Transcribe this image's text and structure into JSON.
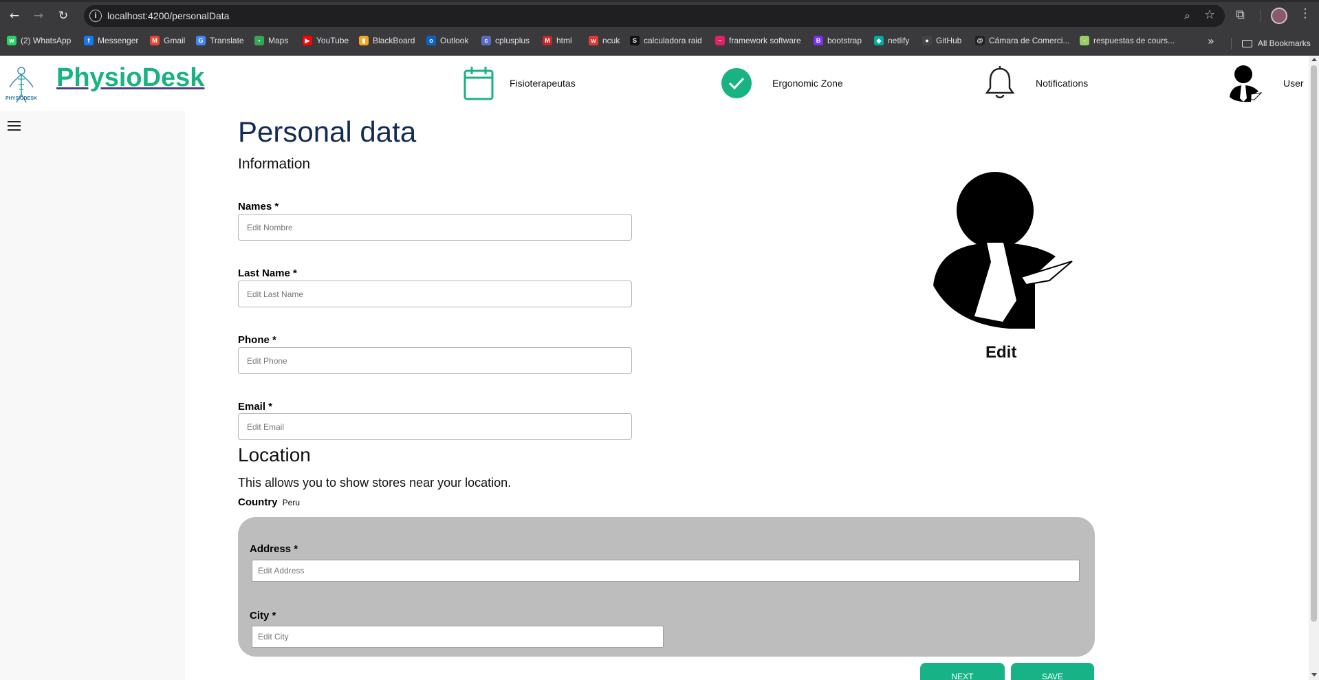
{
  "browser": {
    "url": "localhost:4200/personalData",
    "bookmarks": [
      {
        "label": "(2) WhatsApp",
        "color": "#25d366",
        "glyph": "w"
      },
      {
        "label": "Messenger",
        "color": "#1877f2",
        "glyph": "f"
      },
      {
        "label": "Gmail",
        "color": "#ea4335",
        "glyph": "M"
      },
      {
        "label": "Translate",
        "color": "#4285f4",
        "glyph": "G"
      },
      {
        "label": "Maps",
        "color": "#34a853",
        "glyph": "•"
      },
      {
        "label": "YouTube",
        "color": "#ff0000",
        "glyph": "▶"
      },
      {
        "label": "BlackBoard",
        "color": "#f5a623",
        "glyph": "▮"
      },
      {
        "label": "Outlook",
        "color": "#0a64c9",
        "glyph": "o"
      },
      {
        "label": "cplusplus",
        "color": "#5c6bc0",
        "glyph": "c"
      },
      {
        "label": "html",
        "color": "#c62828",
        "glyph": "M"
      },
      {
        "label": "ncuk",
        "color": "#e53935",
        "glyph": "w"
      },
      {
        "label": "calculadora raid",
        "color": "#111111",
        "glyph": "S"
      },
      {
        "label": "framework software",
        "color": "#e91e63",
        "glyph": "~"
      },
      {
        "label": "bootstrap",
        "color": "#7b2ff7",
        "glyph": "B"
      },
      {
        "label": "netlify",
        "color": "#00ad9f",
        "glyph": "◆"
      },
      {
        "label": "GitHub",
        "color": "#444444",
        "glyph": "●"
      },
      {
        "label": "Cámara de Comerci...",
        "color": "#222222",
        "glyph": "@"
      },
      {
        "label": "respuestas de cours...",
        "color": "#9ccc65",
        "glyph": "▫"
      }
    ],
    "all_bookmarks": "All Bookmarks"
  },
  "header": {
    "brand": "PhysioDesk",
    "logo_text": "PHYSIODESK",
    "nav": [
      {
        "label": "Fisioterapeutas",
        "icon": "calendar-icon"
      },
      {
        "label": "Ergonomic Zone",
        "icon": "check-circle-icon"
      },
      {
        "label": "Notifications",
        "icon": "bell-icon"
      },
      {
        "label": "User",
        "icon": "user-icon"
      }
    ]
  },
  "page": {
    "title": "Personal data",
    "subtitle": "Information",
    "fields": [
      {
        "label": "Names *",
        "placeholder": "Edit Nombre"
      },
      {
        "label": "Last Name *",
        "placeholder": "Edit Last Name"
      },
      {
        "label": "Phone *",
        "placeholder": "Edit Phone"
      },
      {
        "label": "Email *",
        "placeholder": "Edit Email"
      }
    ],
    "avatar_edit": "Edit",
    "location": {
      "title": "Location",
      "description": "This allows you to show stores near your location.",
      "country_label": "Country",
      "country_value": "Peru",
      "address_label": "Address *",
      "address_placeholder": "Edit Address",
      "city_label": "City *",
      "city_placeholder": "Edit City"
    },
    "buttons": {
      "next": "NEXT",
      "save": "SAVE"
    }
  },
  "colors": {
    "brand": "#19b283",
    "title": "#122b56",
    "button": "#17b387",
    "box": "#bdbdbd"
  }
}
